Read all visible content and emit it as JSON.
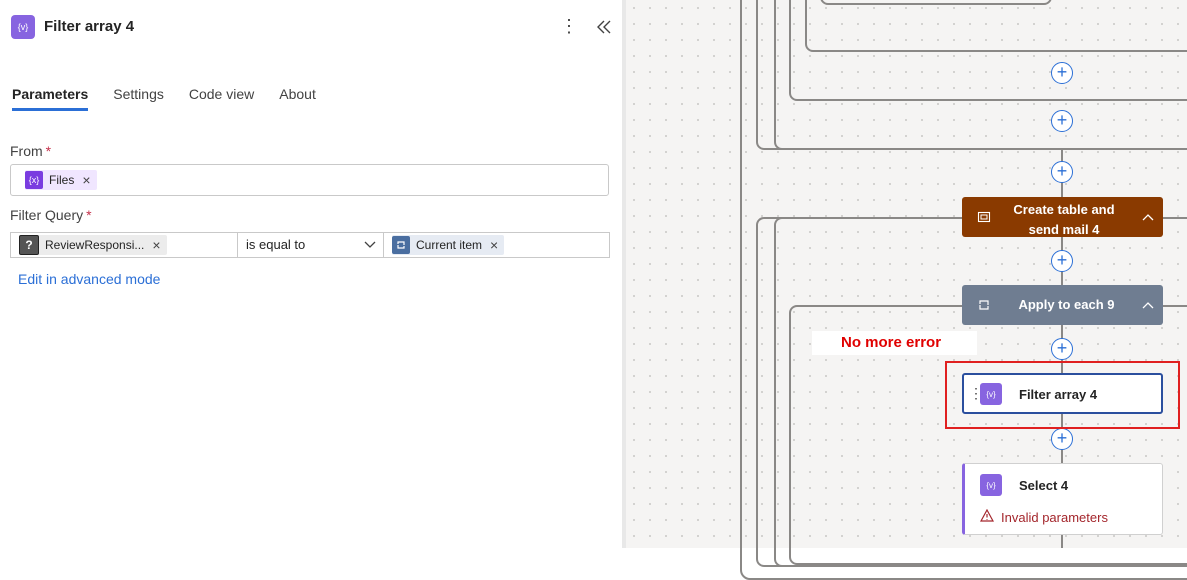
{
  "panel": {
    "title": "Filter array 4",
    "icon_glyph": "{v}",
    "more_glyph": "⋮",
    "tabs": [
      "Parameters",
      "Settings",
      "Code view",
      "About"
    ],
    "from_label": "From",
    "from_token": {
      "glyph": "{x}",
      "label": "Files"
    },
    "filter_label": "Filter Query",
    "filter_left": {
      "glyph": "?",
      "label": "ReviewResponsi..."
    },
    "filter_operator": "is equal to",
    "filter_right": {
      "label": "Current item"
    },
    "advanced_link": "Edit in advanced mode",
    "required_mark": "*",
    "remove_glyph": "×",
    "plus_glyph": "+"
  },
  "canvas": {
    "node_create": {
      "title": "Create table and send mail 4",
      "color": "#8a3a00"
    },
    "node_apply": {
      "title": "Apply to each 9",
      "color": "#6f7d91"
    },
    "node_filter": {
      "title": "Filter array 4"
    },
    "node_select": {
      "title": "Select 4",
      "error": "Invalid parameters"
    },
    "annotation": "No more error",
    "accent": "#2b6fd6"
  }
}
